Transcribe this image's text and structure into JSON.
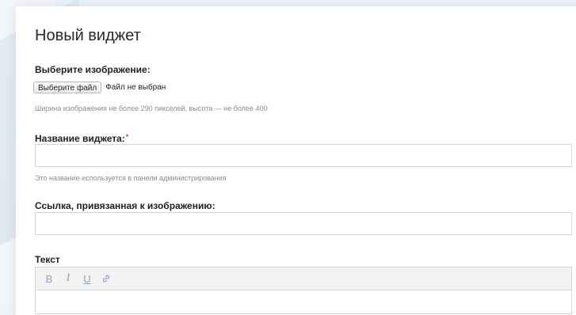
{
  "page_title": "Новый виджет",
  "image_section": {
    "label": "Выберите изображение:",
    "file_button_label": "Выберите файл",
    "file_status": "Файл не выбран",
    "hint": "Ширина изображения не более 290 пикселей, высота — не более 400"
  },
  "widget_name": {
    "label": "Название виджета:",
    "required_mark": "*",
    "value": "",
    "placeholder": "",
    "hint": "Это название используется в панели администрирования"
  },
  "link": {
    "label": "Ссылка, привязанная к изображению:",
    "value": "",
    "placeholder": ""
  },
  "text_section": {
    "label": "Текст",
    "toolbar": [
      {
        "name": "bold",
        "glyph": "B"
      },
      {
        "name": "italic",
        "glyph": "I"
      },
      {
        "name": "underline",
        "glyph": "U"
      },
      {
        "name": "link",
        "glyph": "🔗"
      }
    ]
  },
  "colors": {
    "background": "#eef3f8",
    "card": "#ffffff",
    "required": "#e0443a",
    "toolbar_icon": "#7fa4cf",
    "hint_text": "#8c8c8c"
  }
}
